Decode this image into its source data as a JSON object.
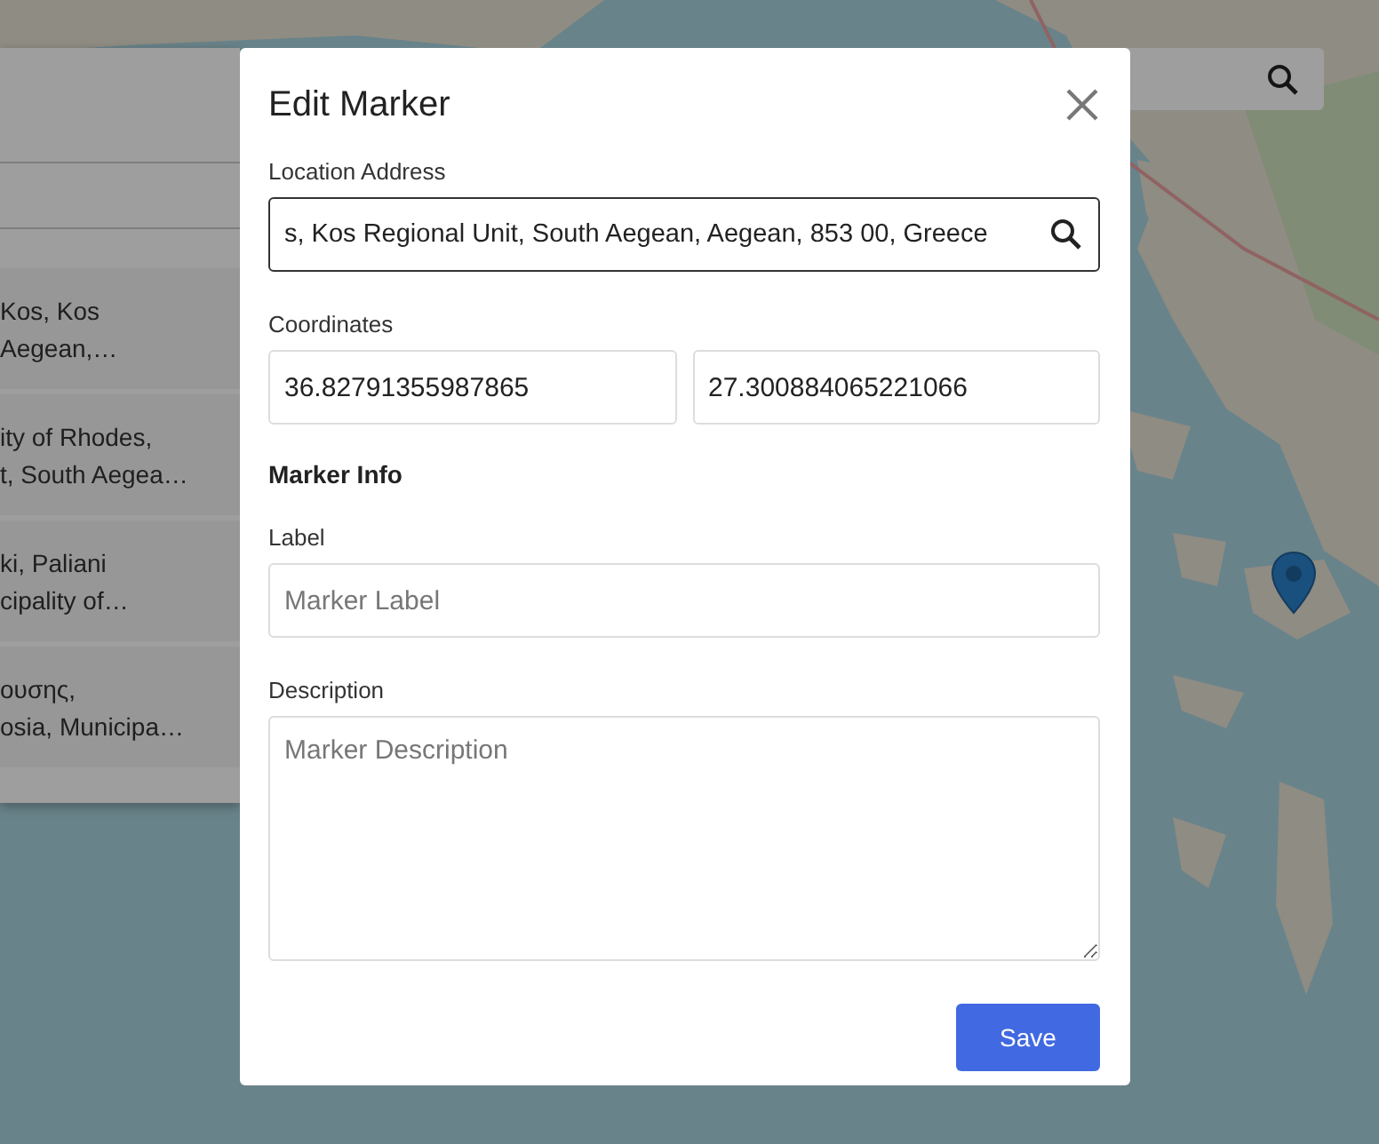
{
  "results_panel": {
    "results": [
      {
        "lines": [
          "Kos, Kos",
          "Aegean,…"
        ]
      },
      {
        "lines": [
          "ity of Rhodes,",
          "t, South Aegea…"
        ]
      },
      {
        "lines": [
          "ki, Paliani",
          "cipality of…"
        ]
      },
      {
        "lines": [
          "ουσης,",
          "osia, Municipa…"
        ]
      }
    ]
  },
  "dialog": {
    "title": "Edit Marker",
    "address": {
      "label": "Location Address",
      "value": "s, Kos Regional Unit, South Aegean, Aegean, 853 00, Greece"
    },
    "coordinates": {
      "label": "Coordinates",
      "latitude": "36.82791355987865",
      "longitude": "27.300884065221066"
    },
    "section_title": "Marker Info",
    "marker_label": {
      "label": "Label",
      "placeholder": "Marker Label"
    },
    "description": {
      "label": "Description",
      "placeholder": "Marker Description"
    },
    "save_button": "Save"
  }
}
